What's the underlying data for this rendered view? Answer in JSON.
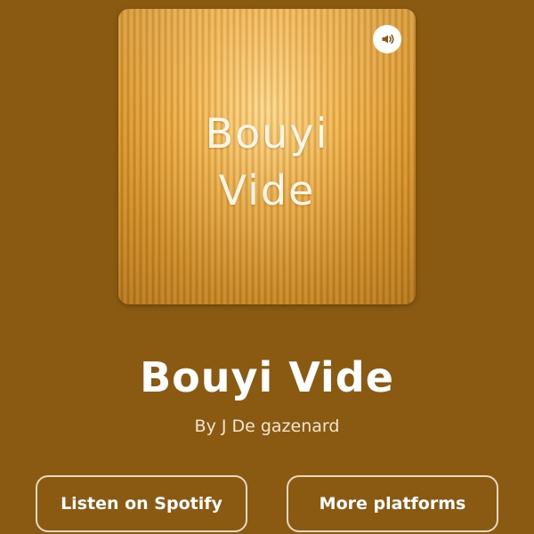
{
  "cover": {
    "title_line1": "Bouyi",
    "title_line2": "Vide",
    "badge_icon": "podcast-broadcast-icon"
  },
  "podcast": {
    "title": "Bouyi Vide",
    "author": "By J De gazenard"
  },
  "buttons": {
    "spotify_label": "Listen on Spotify",
    "more_label": "More platforms"
  },
  "colors": {
    "background": "#8a5a12",
    "cover_gold": "#f2b24a",
    "button_border": "#e7d8c0",
    "text": "#ffffff"
  }
}
